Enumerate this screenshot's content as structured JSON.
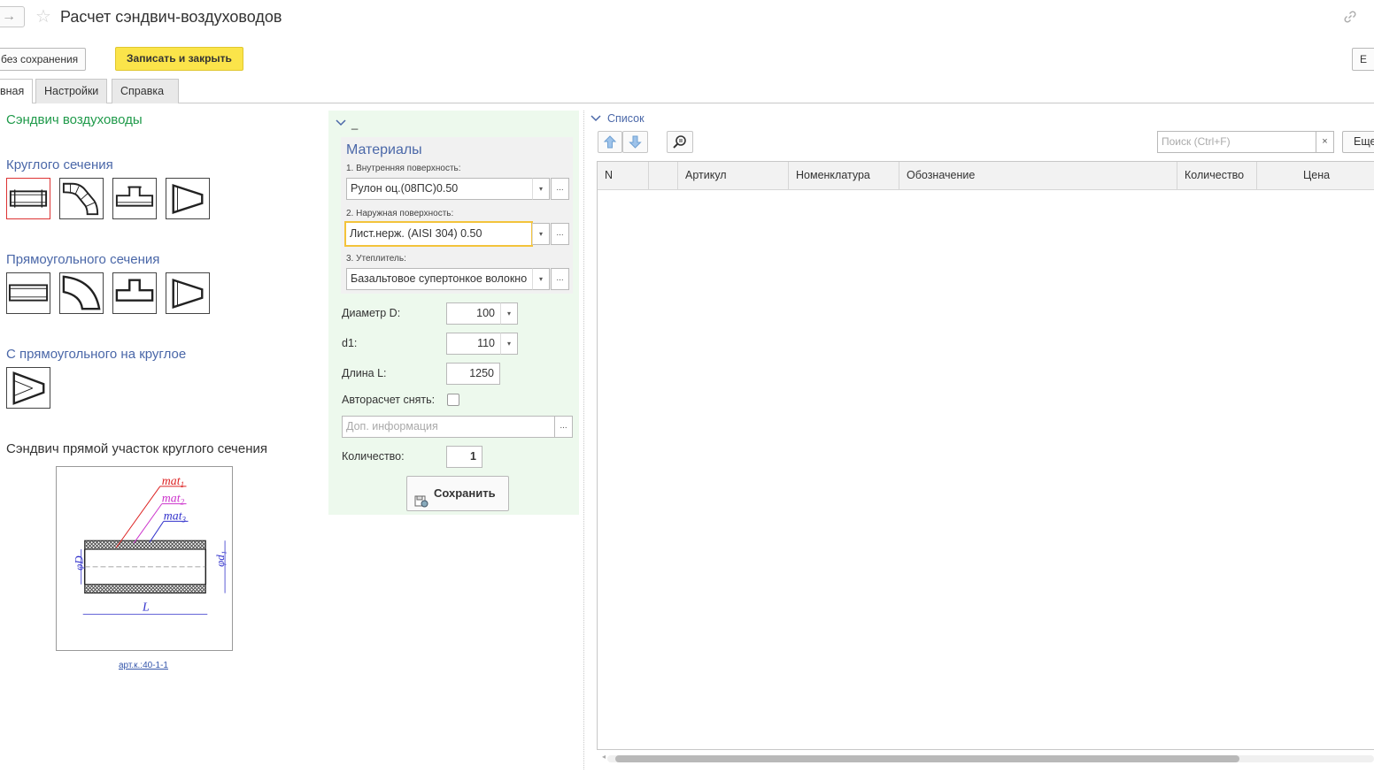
{
  "window": {
    "title": "Расчет сэндвич-воздуховодов"
  },
  "header": {
    "nav_arrow": "→",
    "star_icon": "☆"
  },
  "toolbar": {
    "close_no_save_label": "и без сохранения",
    "save_close_label": "Записать и закрыть",
    "more_top_label": "Е"
  },
  "tabs": [
    {
      "label": "вная"
    },
    {
      "label": "Настройки"
    },
    {
      "label": "Справка"
    }
  ],
  "left": {
    "heading": "Сэндвич воздуховоды",
    "round_heading": "Круглого сечения",
    "rect_heading": "Прямоугольного сечения",
    "transition_heading": "С прямоугольного на круглое",
    "preview_caption": "Сэндвич прямой участок круглого сечения",
    "drawing_labels": {
      "mat1": "mat",
      "mat1_sub": "1",
      "mat2": "mat",
      "mat2_sub": "2",
      "mat3": "mat",
      "mat3_sub": "3",
      "D": "φD",
      "d1": "φd₁",
      "L": "L"
    },
    "article_link": "арт.к.:40-1-1"
  },
  "middle": {
    "group_title": "_",
    "materials_title": "Материалы",
    "inner_label": "1. Внутренняя поверхность:",
    "inner_value": "Рулон оц.(08ПС)0.50",
    "outer_label": "2. Наружная поверхность:",
    "outer_value": "Лист.нерж. (AISI 304) 0.50",
    "insulation_label": "3. Утеплитель:",
    "insulation_value": "Базальтовое супертонкое волокно",
    "diameter_label": "Диаметр D:",
    "diameter_value": "100",
    "d1_label": "d1:",
    "d1_value": "110",
    "length_label": "Длина L:",
    "length_value": "1250",
    "autocalc_label": "Авторасчет снять:",
    "extra_placeholder": "Доп. информация",
    "quantity_label": "Количество:",
    "quantity_value": "1",
    "save_label": "Сохранить",
    "dots": "...",
    "dropdown_icon": "▾"
  },
  "list": {
    "title": "Список",
    "search_placeholder": "Поиск (Ctrl+F)",
    "clear": "×",
    "more_label": "Еще",
    "columns": [
      "N",
      "",
      "Артикул",
      "Номенклатура",
      "Обозначение",
      "Количество",
      "Цена"
    ],
    "rows": []
  },
  "colors": {
    "accent_yellow": "#fbe44a",
    "heading_green": "#1f9a4a",
    "heading_blue": "#4a67a8",
    "panel_green": "#edf9ed"
  }
}
